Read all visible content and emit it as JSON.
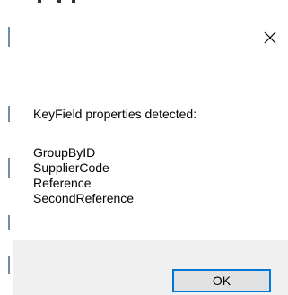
{
  "dialog": {
    "close_icon": "close-icon",
    "message": "KeyField properties detected:",
    "items": [
      "GroupByID",
      "SupplierCode",
      "Reference",
      "SecondReference"
    ],
    "ok_label": "OK",
    "accent_color": "#0078d7",
    "footer_color": "#f0f0f0"
  }
}
